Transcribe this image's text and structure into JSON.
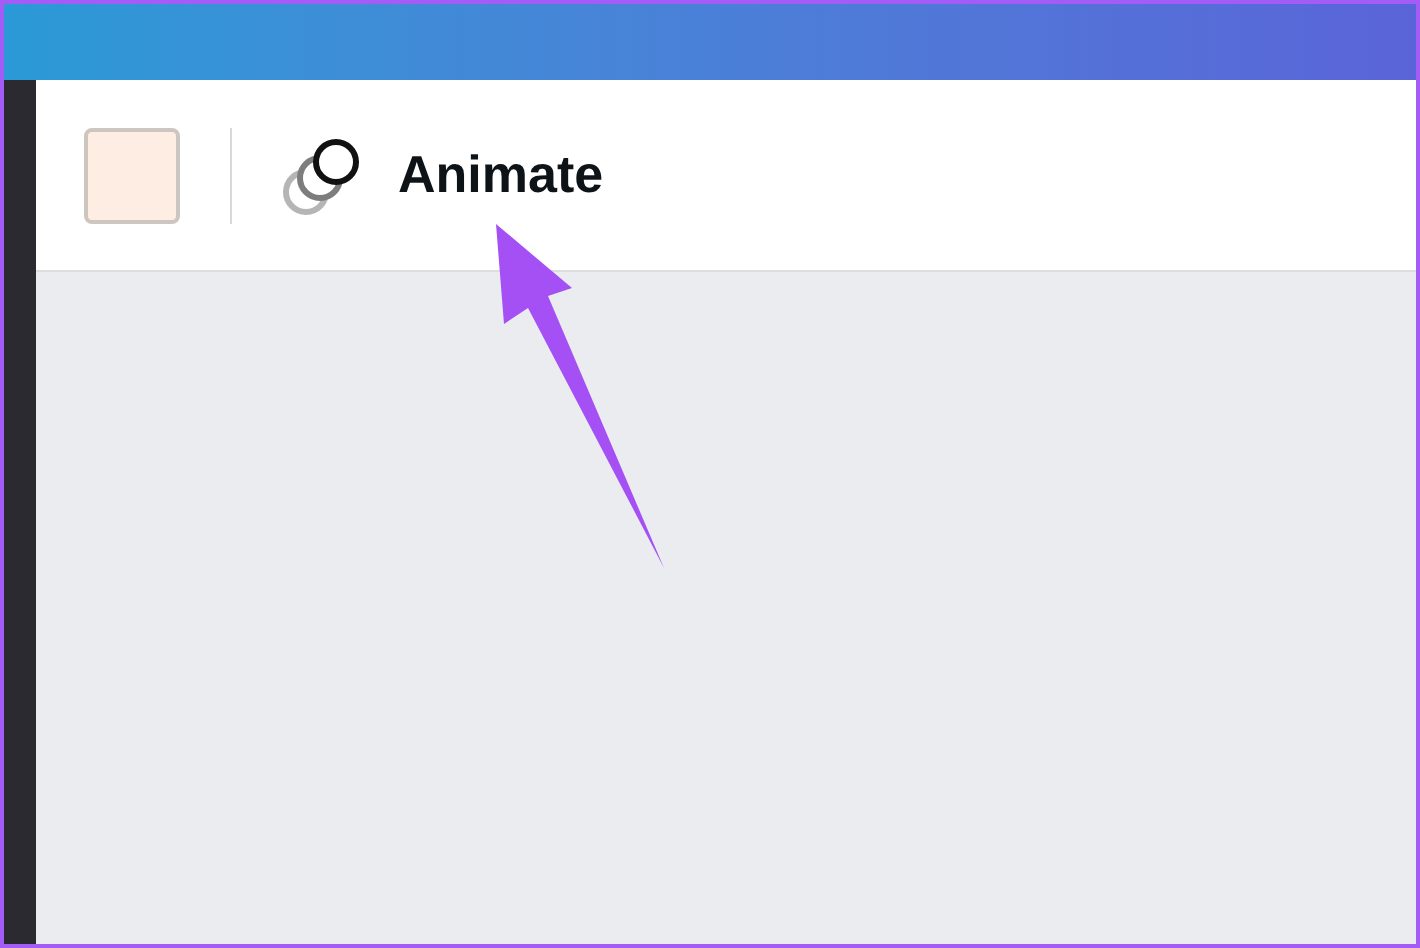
{
  "toolbar": {
    "color_swatch": {
      "color": "#feede2"
    },
    "animate_button": {
      "label": "Animate"
    }
  }
}
